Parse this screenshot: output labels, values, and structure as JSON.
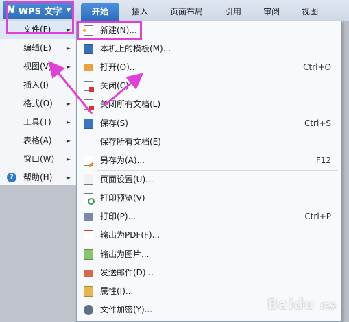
{
  "app": {
    "logo": "N",
    "title": "WPS 文字",
    "caret": "▼"
  },
  "tabs": [
    {
      "label": "开始",
      "active": true
    },
    {
      "label": "插入"
    },
    {
      "label": "页面布局"
    },
    {
      "label": "引用"
    },
    {
      "label": "审阅"
    },
    {
      "label": "视图"
    }
  ],
  "main_menu": [
    {
      "label": "文件(F)",
      "arrow": "►",
      "selected": true
    },
    {
      "label": "编辑(E)",
      "arrow": "►"
    },
    {
      "label": "视图(V)",
      "arrow": "►"
    },
    {
      "label": "插入(I)",
      "arrow": "►"
    },
    {
      "label": "格式(O)",
      "arrow": "►"
    },
    {
      "label": "工具(T)",
      "arrow": "►"
    },
    {
      "label": "表格(A)",
      "arrow": "►"
    },
    {
      "label": "窗口(W)",
      "arrow": "►"
    },
    {
      "label": "帮助(H)",
      "arrow": "►",
      "icon": "?"
    }
  ],
  "file_menu": [
    {
      "label": "新建(N)...",
      "icon": "new-document-icon"
    },
    {
      "label": "本机上的模板(M)...",
      "icon": "template-icon"
    },
    {
      "label": "打开(O)...",
      "shortcut": "Ctrl+O",
      "icon": "folder-open-icon"
    },
    {
      "label": "关闭(C)",
      "icon": "close-document-icon"
    },
    {
      "label": "关闭所有文档(L)",
      "icon": "close-all-icon"
    },
    {
      "label": "保存(S)",
      "shortcut": "Ctrl+S",
      "icon": "save-icon"
    },
    {
      "label": "保存所有文档(E)"
    },
    {
      "label": "另存为(A)...",
      "shortcut": "F12",
      "icon": "save-as-icon"
    },
    {
      "label": "页面设置(U)...",
      "icon": "page-setup-icon"
    },
    {
      "label": "打印预览(V)",
      "icon": "print-preview-icon"
    },
    {
      "label": "打印(P)...",
      "shortcut": "Ctrl+P",
      "icon": "printer-icon"
    },
    {
      "label": "输出为PDF(F)...",
      "icon": "pdf-icon"
    },
    {
      "label": "输出为图片...",
      "icon": "image-export-icon"
    },
    {
      "label": "发送邮件(D)...",
      "icon": "mail-icon"
    },
    {
      "label": "属性(I)...",
      "icon": "properties-icon"
    },
    {
      "label": "文件加密(Y)...",
      "icon": "encrypt-icon"
    }
  ],
  "watermark": {
    "text": "Bai",
    "text2": "du",
    "suffix": "经验"
  },
  "colors": {
    "accent": "#2e6fb8",
    "annotation": "#e040d8"
  }
}
